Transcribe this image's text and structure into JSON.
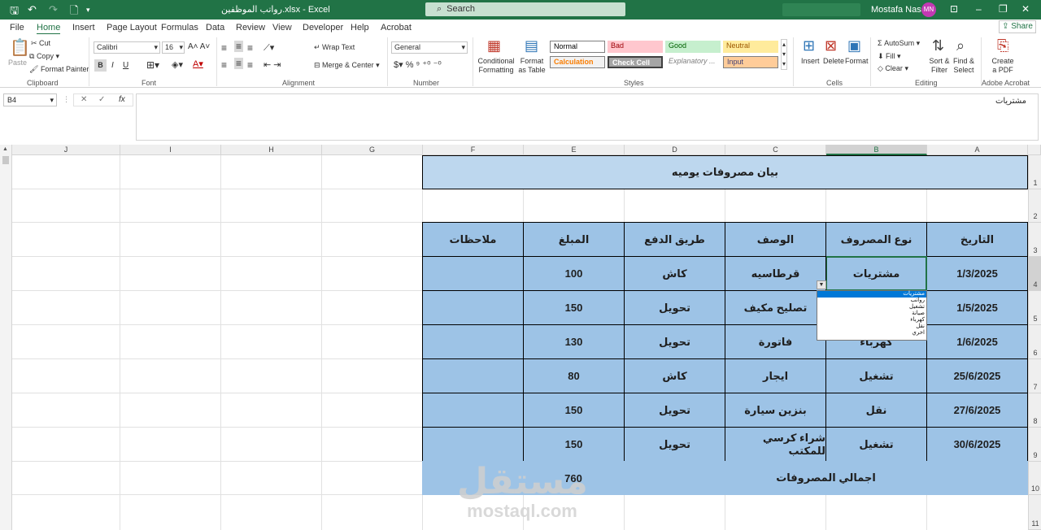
{
  "titlebar": {
    "doc_title": "رواتب الموظفين.xlsx - Excel",
    "search_placeholder": "Search",
    "user_name": "Mostafa Nasser",
    "user_initials": "MN"
  },
  "menu": {
    "tabs": [
      "File",
      "Home",
      "Insert",
      "Page Layout",
      "Formulas",
      "Data",
      "Review",
      "View",
      "Developer",
      "Help",
      "Acrobat"
    ],
    "active_tab": "Home",
    "share_label": "Share"
  },
  "ribbon": {
    "clipboard": {
      "paste": "Paste",
      "cut": "Cut",
      "copy": "Copy",
      "format_painter": "Format Painter",
      "label": "Clipboard"
    },
    "font": {
      "name": "Calibri",
      "size": "16",
      "bold": "B",
      "italic": "I",
      "underline": "U",
      "label": "Font"
    },
    "alignment": {
      "wrap_text": "Wrap Text",
      "merge_center": "Merge & Center",
      "label": "Alignment"
    },
    "number": {
      "format": "General",
      "label": "Number"
    },
    "styles": {
      "conditional": "Conditional Formatting",
      "format_table": "Format as Table",
      "cells": [
        "Normal",
        "Bad",
        "Good",
        "Neutral",
        "Calculation",
        "Check Cell",
        "Explanatory ...",
        "Input"
      ],
      "label": "Styles"
    },
    "cells": {
      "insert": "Insert",
      "delete": "Delete",
      "format": "Format",
      "label": "Cells"
    },
    "editing": {
      "autosum": "AutoSum",
      "fill": "Fill",
      "clear": "Clear",
      "sort_filter": "Sort & Filter",
      "find_select": "Find & Select",
      "label": "Editing"
    },
    "acrobat": {
      "create_pdf": "Create a PDF",
      "label": "Adobe Acrobat"
    }
  },
  "formula_bar": {
    "name_box": "B4",
    "content": "مشتريات"
  },
  "sheet": {
    "columns": [
      "J",
      "I",
      "H",
      "G",
      "F",
      "E",
      "D",
      "C",
      "B",
      "A"
    ],
    "rows": [
      "1",
      "2",
      "3",
      "4",
      "5",
      "6",
      "7",
      "8",
      "9",
      "10",
      "11"
    ],
    "title": "بيان مصروفات يوميه",
    "headers": [
      "التاريخ",
      "نوع المصروف",
      "الوصف",
      "طريق الدفع",
      "المبلغ",
      "ملاحظات"
    ],
    "data_rows": [
      [
        "1/3/2025",
        "مشتريات",
        "قرطاسيه",
        "كاش",
        "100",
        ""
      ],
      [
        "1/5/2025",
        "",
        "تصليح مكيف",
        "تحويل",
        "150",
        ""
      ],
      [
        "1/6/2025",
        "كهرباء",
        "فاتورة",
        "تحويل",
        "130",
        ""
      ],
      [
        "25/6/2025",
        "تشغيل",
        "ايجار",
        "كاش",
        "80",
        ""
      ],
      [
        "27/6/2025",
        "نقل",
        "بنزين سيارة",
        "تحويل",
        "150",
        ""
      ],
      [
        "30/6/2025",
        "تشغيل",
        "شراء كرسي للمكتب",
        "تحويل",
        "150",
        ""
      ]
    ],
    "total_label": "اجمالي المصروفات",
    "total_value": "760"
  },
  "dropdown": {
    "options": [
      "مشتريات",
      "رواتب",
      "تشغيل",
      "صيانة",
      "كهرباء",
      "نقل",
      "اخري"
    ],
    "selected": 0
  },
  "watermark": {
    "logo": "مستقل",
    "url": "mostaql.com"
  },
  "colors": {
    "excel_green": "#217346",
    "header_blue": "#9dc3e6",
    "title_blue": "#bdd7ee"
  }
}
